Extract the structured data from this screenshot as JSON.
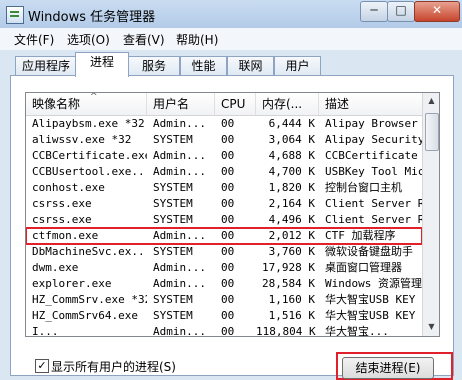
{
  "window": {
    "title": "Windows 任务管理器",
    "min_label": "─",
    "max_label": "□",
    "close_label": "✕"
  },
  "menu": [
    "文件(F)",
    "选项(O)",
    "查看(V)",
    "帮助(H)"
  ],
  "tabs": [
    "应用程序",
    "进程",
    "服务",
    "性能",
    "联网",
    "用户"
  ],
  "active_tab": "进程",
  "columns": [
    "映像名称",
    "用户名",
    "CPU",
    "内存(...",
    "描述"
  ],
  "sort_indicator": "^",
  "processes": [
    {
      "name": "Alipaybsm.exe *32",
      "user": "Admin...",
      "cpu": "00",
      "mem": "6,444 K",
      "desc": "Alipay Browser S"
    },
    {
      "name": "aliwssv.exe *32",
      "user": "SYSTEM",
      "cpu": "00",
      "mem": "3,064 K",
      "desc": "Alipay Security"
    },
    {
      "name": "CCBCertificate.exe",
      "user": "Admin...",
      "cpu": "00",
      "mem": "4,688 K",
      "desc": "CCBCertificate"
    },
    {
      "name": "CCBUsertool.exe...",
      "user": "Admin...",
      "cpu": "00",
      "mem": "4,700 K",
      "desc": "USBKey Tool Micr"
    },
    {
      "name": "conhost.exe",
      "user": "SYSTEM",
      "cpu": "00",
      "mem": "1,820 K",
      "desc": "控制台窗口主机"
    },
    {
      "name": "csrss.exe",
      "user": "SYSTEM",
      "cpu": "00",
      "mem": "2,164 K",
      "desc": "Client Server Ru"
    },
    {
      "name": "csrss.exe",
      "user": "SYSTEM",
      "cpu": "00",
      "mem": "4,496 K",
      "desc": "Client Server Ru"
    },
    {
      "name": "ctfmon.exe",
      "user": "Admin...",
      "cpu": "00",
      "mem": "2,012 K",
      "desc": "CTF 加载程序"
    },
    {
      "name": "DbMachineSvc.ex...",
      "user": "SYSTEM",
      "cpu": "00",
      "mem": "3,760 K",
      "desc": "微软设备键盘助手"
    },
    {
      "name": "dwm.exe",
      "user": "Admin...",
      "cpu": "00",
      "mem": "17,928 K",
      "desc": "桌面窗口管理器"
    },
    {
      "name": "explorer.exe",
      "user": "Admin...",
      "cpu": "00",
      "mem": "28,584 K",
      "desc": "Windows 资源管理"
    },
    {
      "name": "HZ_CommSrv.exe *32",
      "user": "SYSTEM",
      "cpu": "00",
      "mem": "1,160 K",
      "desc": "华大智宝USB KEY"
    },
    {
      "name": "HZ_CommSrv64.exe",
      "user": "SYSTEM",
      "cpu": "00",
      "mem": "1,516 K",
      "desc": "华大智宝USB KEY"
    },
    {
      "name": "I...",
      "user": "Admin...",
      "cpu": "00",
      "mem": "118,804 K",
      "desc": "华大智宝..."
    }
  ],
  "highlighted_process": "ctfmon.exe",
  "show_all_users": {
    "checked": true,
    "label": "显示所有用户的进程(S)",
    "check_mark": "✓"
  },
  "end_process_label": "结束进程(E)",
  "scroll": {
    "up": "▲",
    "down": "▼"
  },
  "colors": {
    "highlight": "#e0202a",
    "titlebar": "#c9dcf1"
  }
}
